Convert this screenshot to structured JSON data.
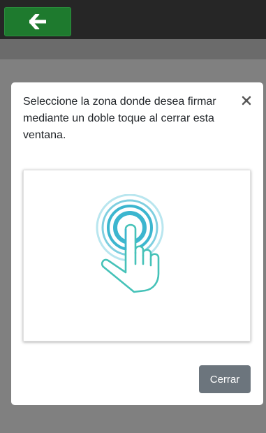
{
  "header": {
    "back_icon": "arrow-left-icon"
  },
  "modal": {
    "title": "Seleccione la zona donde desea firmar mediante un doble toque al cerrar esta ventana.",
    "close_icon": "close-icon",
    "illustration_icon": "double-tap-hand-icon",
    "close_button_label": "Cerrar"
  },
  "colors": {
    "topbar": "#262626",
    "back_button": "#1e7a2e",
    "overlay": "#808080",
    "illustration": "#3cb6cf",
    "close_button": "#6c757d"
  }
}
